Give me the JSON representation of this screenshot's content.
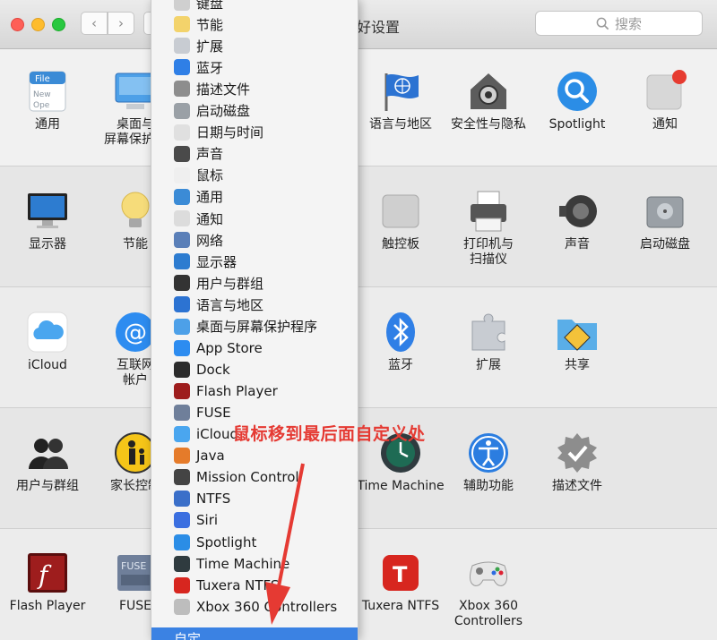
{
  "window": {
    "title_visible": "好设置"
  },
  "search": {
    "placeholder": "搜索"
  },
  "annotation": {
    "text": "鼠标移到最后面自定义处",
    "color": "#e53a33"
  },
  "panes": {
    "row1": [
      {
        "id": "general",
        "label": "通用",
        "icon": "file-icon"
      },
      {
        "id": "desktop",
        "label": "桌面与\n屏幕保护程",
        "icon": "desktop-icon"
      },
      {
        "id": "language",
        "label": "语言与地区",
        "icon": "flag-icon"
      },
      {
        "id": "security",
        "label": "安全性与隐私",
        "icon": "house-lock-icon"
      },
      {
        "id": "spotlight",
        "label": "Spotlight",
        "icon": "magnifier-icon"
      },
      {
        "id": "notifications",
        "label": "通知",
        "icon": "notification-icon"
      }
    ],
    "row2": [
      {
        "id": "displays",
        "label": "显示器",
        "icon": "monitor-icon"
      },
      {
        "id": "energy",
        "label": "节能",
        "icon": "bulb-icon"
      },
      {
        "id": "trackpad",
        "label": "触控板",
        "icon": "trackpad-icon"
      },
      {
        "id": "printers",
        "label": "打印机与\n扫描仪",
        "icon": "printer-icon"
      },
      {
        "id": "sound",
        "label": "声音",
        "icon": "speaker-icon"
      },
      {
        "id": "startup",
        "label": "启动磁盘",
        "icon": "disk-icon"
      }
    ],
    "row3": [
      {
        "id": "icloud",
        "label": "iCloud",
        "icon": "cloud-icon"
      },
      {
        "id": "internet",
        "label": "互联网\n帐户",
        "icon": "at-icon"
      },
      {
        "id": "bluetooth",
        "label": "蓝牙",
        "icon": "bluetooth-icon"
      },
      {
        "id": "extensions",
        "label": "扩展",
        "icon": "puzzle-icon"
      },
      {
        "id": "sharing",
        "label": "共享",
        "icon": "folder-sharing-icon"
      }
    ],
    "row4": [
      {
        "id": "users",
        "label": "用户与群组",
        "icon": "users-icon"
      },
      {
        "id": "parental",
        "label": "家长控制",
        "icon": "parental-icon"
      },
      {
        "id": "timemachine",
        "label": "Time Machine",
        "icon": "clock-icon"
      },
      {
        "id": "accessibility",
        "label": "辅助功能",
        "icon": "accessibility-icon"
      },
      {
        "id": "profiles",
        "label": "描述文件",
        "icon": "badge-check-icon"
      }
    ],
    "row5": [
      {
        "id": "flash",
        "label": "Flash Player",
        "icon": "flash-icon"
      },
      {
        "id": "fuse",
        "label": "FUSE",
        "icon": "fuse-icon"
      },
      {
        "id": "tuxera",
        "label": "Tuxera NTFS",
        "icon": "tuxera-icon"
      },
      {
        "id": "xbox",
        "label": "Xbox 360\nControllers",
        "icon": "gamepad-icon"
      }
    ]
  },
  "menu": {
    "items": [
      {
        "label": "键盘",
        "icon": "keyboard-icon",
        "color": "#cfcfcf"
      },
      {
        "label": "节能",
        "icon": "bulb-icon",
        "color": "#f3d36b"
      },
      {
        "label": "扩展",
        "icon": "puzzle-icon",
        "color": "#c8ccd2"
      },
      {
        "label": "蓝牙",
        "icon": "bluetooth-icon",
        "color": "#2f7fe6"
      },
      {
        "label": "描述文件",
        "icon": "badge-check-icon",
        "color": "#8d8d8d"
      },
      {
        "label": "启动磁盘",
        "icon": "disk-icon",
        "color": "#9aa0a6"
      },
      {
        "label": "日期与时间",
        "icon": "calendar-icon",
        "color": "#e0e0e0"
      },
      {
        "label": "声音",
        "icon": "speaker-icon",
        "color": "#4a4a4a"
      },
      {
        "label": "鼠标",
        "icon": "mouse-icon",
        "color": "#efefef"
      },
      {
        "label": "通用",
        "icon": "file-icon",
        "color": "#3b8bd6"
      },
      {
        "label": "通知",
        "icon": "notification-icon",
        "color": "#dcdcdc"
      },
      {
        "label": "网络",
        "icon": "globe-icon",
        "color": "#5a7fb8"
      },
      {
        "label": "显示器",
        "icon": "monitor-icon",
        "color": "#2d7cd0"
      },
      {
        "label": "用户与群组",
        "icon": "users-icon",
        "color": "#333333"
      },
      {
        "label": "语言与地区",
        "icon": "flag-icon",
        "color": "#2c73d2"
      },
      {
        "label": "桌面与屏幕保护程序",
        "icon": "desktop-icon",
        "color": "#4da0e8"
      },
      {
        "label": "App Store",
        "icon": "appstore-icon",
        "color": "#2d8cf0"
      },
      {
        "label": "Dock",
        "icon": "dock-icon",
        "color": "#2b2b2b"
      },
      {
        "label": "Flash Player",
        "icon": "flash-icon",
        "color": "#9e1d1d"
      },
      {
        "label": "FUSE",
        "icon": "fuse-icon",
        "color": "#6f7f9a"
      },
      {
        "label": "iCloud",
        "icon": "cloud-icon",
        "color": "#4aa6ef"
      },
      {
        "label": "Java",
        "icon": "java-icon",
        "color": "#e57b2a"
      },
      {
        "label": "Mission Control",
        "icon": "mission-icon",
        "color": "#444444"
      },
      {
        "label": "NTFS",
        "icon": "ntfs-icon",
        "color": "#3a6fc9"
      },
      {
        "label": "Siri",
        "icon": "siri-icon",
        "color": "#3b6fe0"
      },
      {
        "label": "Spotlight",
        "icon": "magnifier-icon",
        "color": "#2b8de6"
      },
      {
        "label": "Time Machine",
        "icon": "clock-icon",
        "color": "#2f3b3f"
      },
      {
        "label": "Tuxera NTFS",
        "icon": "tuxera-icon",
        "color": "#d7261f"
      },
      {
        "label": "Xbox 360 Controllers",
        "icon": "gamepad-icon",
        "color": "#bdbdbd"
      }
    ],
    "customize": "自定"
  }
}
